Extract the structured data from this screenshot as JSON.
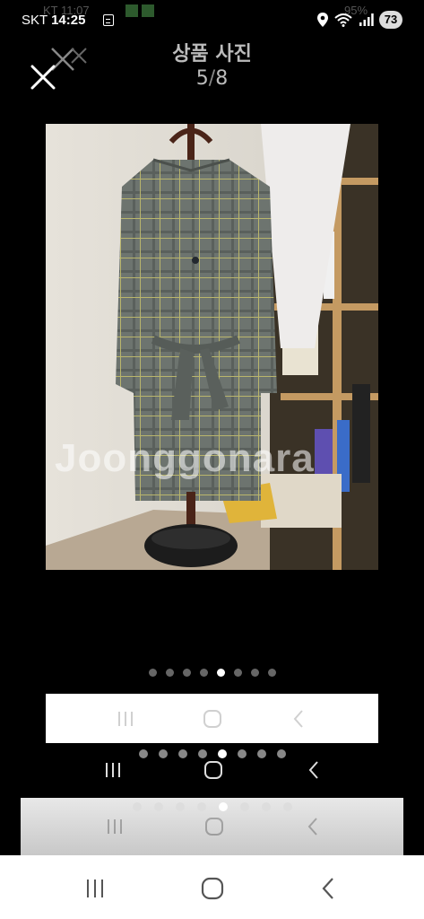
{
  "status_bar": {
    "ghost_carrier": "KT 11:07",
    "ghost_battery": "95%",
    "carrier": "SKT",
    "time": "14:25",
    "battery": "73",
    "icons": [
      "sim-card-icon",
      "location-icon",
      "wifi-icon",
      "signal-icon"
    ]
  },
  "header": {
    "title": "상품 사진",
    "current": "5",
    "separator": "/",
    "total": "8",
    "close_icon": "close-icon"
  },
  "photo": {
    "description_icon": "product-photo",
    "watermark": "Joonggonara"
  },
  "pagination": {
    "count": 8,
    "active_index": 4
  },
  "nav": {
    "icons": [
      "recent-apps-icon",
      "home-icon",
      "back-icon"
    ]
  },
  "colors": {
    "background": "#000000",
    "title": "#bbbbbb",
    "dot_inactive": "#666666",
    "dot_active": "#ffffff",
    "nav_icon_dark": "#555555"
  }
}
